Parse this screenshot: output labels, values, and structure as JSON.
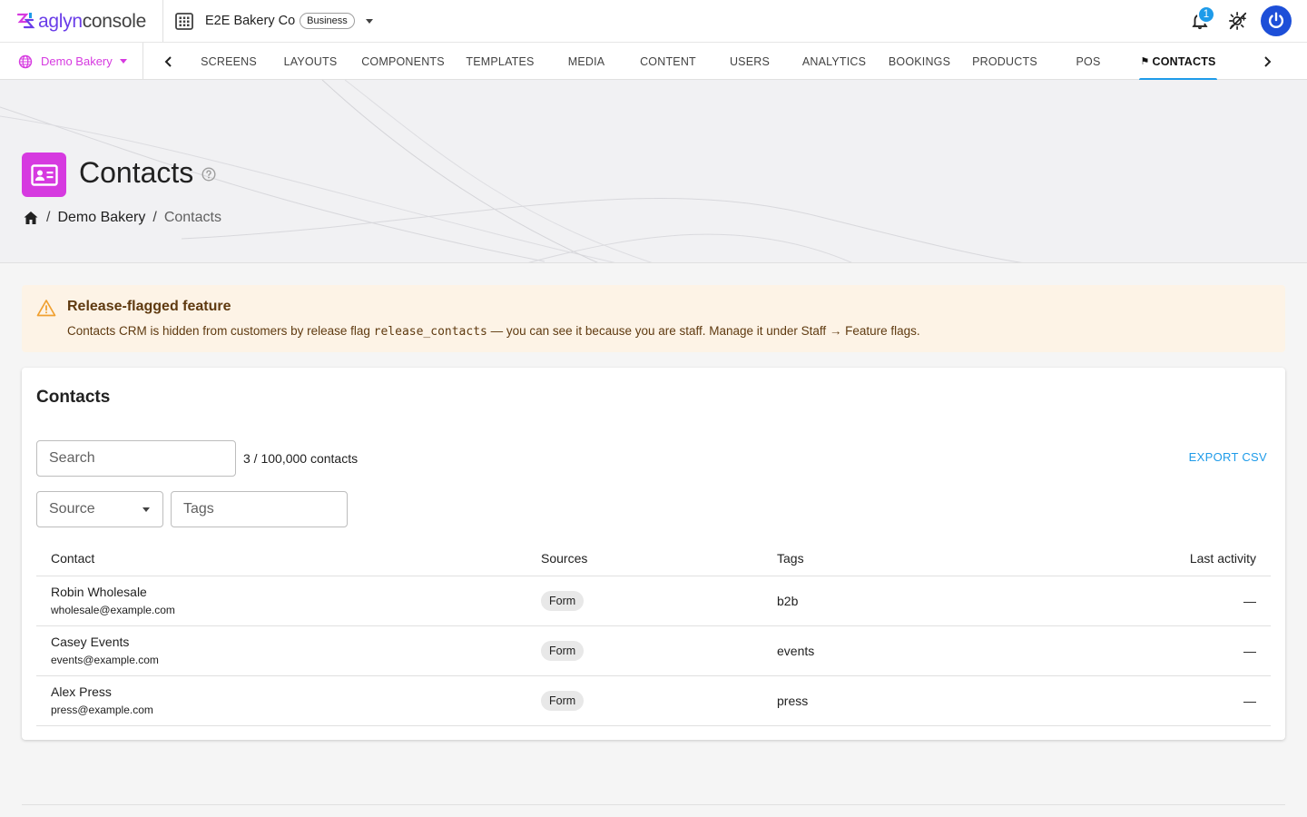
{
  "app": {
    "brand_prefix": "aglyn",
    "brand_suffix": "console"
  },
  "org": {
    "name": "E2E Bakery Co",
    "plan": "Business"
  },
  "notifications": {
    "count": "1"
  },
  "site": {
    "name": "Demo Bakery"
  },
  "nav": {
    "tabs": [
      "SCREENS",
      "LAYOUTS",
      "COMPONENTS",
      "TEMPLATES",
      "MEDIA",
      "CONTENT",
      "USERS",
      "ANALYTICS",
      "BOOKINGS",
      "PRODUCTS",
      "POS",
      "CONTACTS"
    ],
    "active": "CONTACTS"
  },
  "page": {
    "title": "Contacts",
    "breadcrumb": [
      "Demo Bakery",
      "Contacts"
    ]
  },
  "alert": {
    "title": "Release-flagged feature",
    "body_before": "Contacts CRM is hidden from customers by release flag ",
    "flag_code": "release_contacts",
    "body_after": " — you can see it because you are staff. Manage it under Staff → Feature flags."
  },
  "card": {
    "title": "Contacts",
    "search_placeholder": "Search",
    "count_text": "3 / 100,000 contacts",
    "export_label": "EXPORT CSV",
    "source_label": "Source",
    "tags_placeholder": "Tags"
  },
  "table": {
    "headers": {
      "contact": "Contact",
      "sources": "Sources",
      "tags": "Tags",
      "last_activity": "Last activity"
    },
    "rows": [
      {
        "name": "Robin Wholesale",
        "email": "wholesale@example.com",
        "source": "Form",
        "tags": "b2b",
        "last_activity": "—"
      },
      {
        "name": "Casey Events",
        "email": "events@example.com",
        "source": "Form",
        "tags": "events",
        "last_activity": "—"
      },
      {
        "name": "Alex Press",
        "email": "press@example.com",
        "source": "Form",
        "tags": "press",
        "last_activity": "—"
      }
    ]
  },
  "colors": {
    "accent": "#1e9be9",
    "brand_magenta": "#d63ae0",
    "alert_bg": "#fdf3e6"
  },
  "icons": {
    "brand": "aglyn-logo-icon",
    "org": "building-icon",
    "notifications": "bell-icon",
    "theme": "theme-toggle-icon",
    "account": "power-avatar-icon",
    "site": "globe-icon",
    "page": "contact-card-icon",
    "help": "help-circle-icon",
    "home": "home-icon",
    "alert": "warning-icon"
  }
}
